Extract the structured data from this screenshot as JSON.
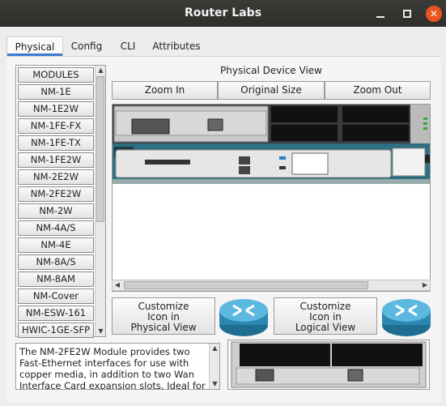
{
  "window": {
    "title": "Router Labs",
    "minimize_label": "–",
    "maximize_label": "□",
    "close_label": "✕"
  },
  "tabs": [
    {
      "label": "Physical",
      "active": true
    },
    {
      "label": "Config",
      "active": false
    },
    {
      "label": "CLI",
      "active": false
    },
    {
      "label": "Attributes",
      "active": false
    }
  ],
  "modules": {
    "header": "MODULES",
    "items": [
      "NM-1E",
      "NM-1E2W",
      "NM-1FE-FX",
      "NM-1FE-TX",
      "NM-1FE2W",
      "NM-2E2W",
      "NM-2FE2W",
      "NM-2W",
      "NM-4A/S",
      "NM-4E",
      "NM-8A/S",
      "NM-8AM",
      "NM-Cover",
      "NM-ESW-161",
      "HWIC-1GE-SFP"
    ]
  },
  "device_view": {
    "label": "Physical Device View",
    "zoom_in": "Zoom In",
    "original_size": "Original Size",
    "zoom_out": "Zoom Out"
  },
  "customize": {
    "physical": [
      "Customize",
      "Icon in",
      "Physical View"
    ],
    "logical": [
      "Customize",
      "Icon in",
      "Logical View"
    ]
  },
  "description": "The NM-2FE2W Module provides two Fast-Ethernet interfaces for use with copper media, in addition to two Wan Interface Card expansion slots. Ideal for a",
  "colors": {
    "accent": "#3a7ad0",
    "close_button": "#e95420",
    "router_teal": "#2f6f82",
    "router_icon": "#3fa0c8"
  }
}
